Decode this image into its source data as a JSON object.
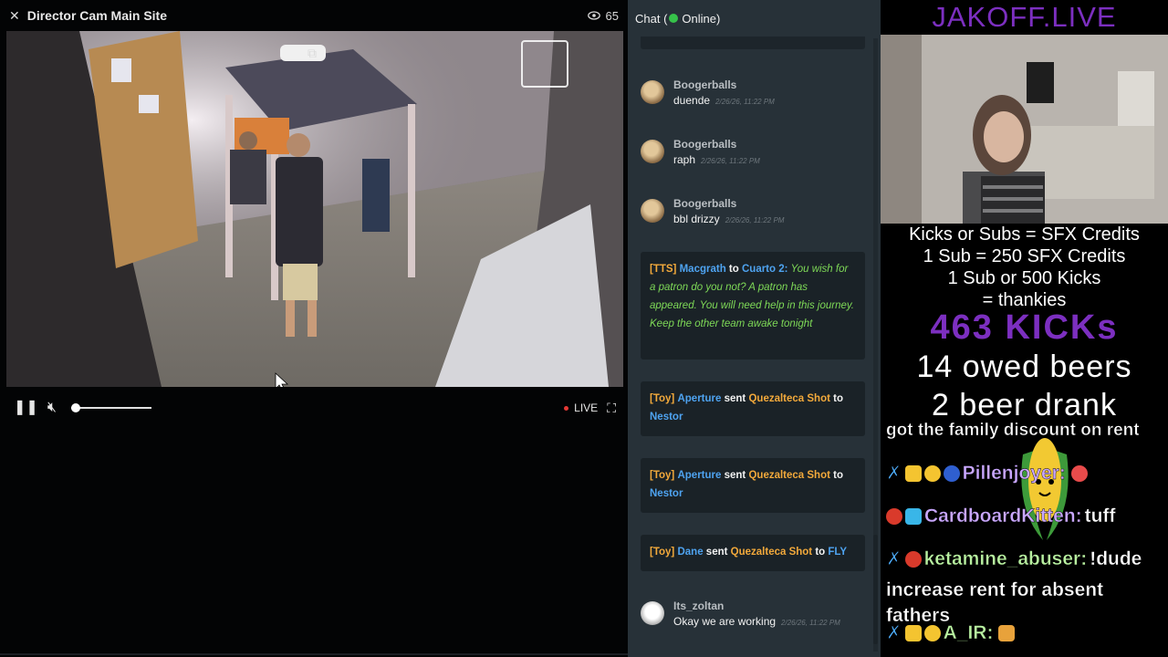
{
  "player": {
    "title": "Director Cam Main Site",
    "viewer_count": "65",
    "live_label": "LIVE",
    "volume_fraction": 0.0
  },
  "chat": {
    "header_label": "Chat (",
    "status_label": "Online)",
    "messages": [
      {
        "type": "message",
        "username": "Boogerballs",
        "text": "duende",
        "time": "2/26/26, 11:22 PM"
      },
      {
        "type": "message",
        "username": "Boogerballs",
        "text": "raph",
        "time": "2/26/26, 11:22 PM"
      },
      {
        "type": "message",
        "username": "Boogerballs",
        "text": "bbl drizzy",
        "time": "2/26/26, 11:22 PM"
      },
      {
        "type": "tts",
        "tag": "[TTS]",
        "sender": "Macgrath",
        "connector": "to",
        "target": "Cuarto 2:",
        "text": "You wish for a patron do you not? A patron has appeared. You will need help in this journey. Keep the other team awake tonight"
      },
      {
        "type": "toy",
        "tag": "[Toy]",
        "sender": "Aperture",
        "verb": "sent",
        "item": "Quezalteca Shot",
        "connector": "to",
        "target": "Nestor"
      },
      {
        "type": "toy",
        "tag": "[Toy]",
        "sender": "Aperture",
        "verb": "sent",
        "item": "Quezalteca Shot",
        "connector": "to",
        "target": "Nestor"
      },
      {
        "type": "toy",
        "tag": "[Toy]",
        "sender": "Dane",
        "verb": "sent",
        "item": "Quezalteca Shot",
        "connector": "to",
        "target": "FLY"
      },
      {
        "type": "message",
        "username": "Its_zoltan",
        "text": "Okay we are working",
        "time": "2/26/26, 11:22 PM"
      }
    ]
  },
  "overlay": {
    "title": "JAKOFF.LIVE",
    "lines": [
      "Kicks or Subs = SFX Credits",
      "1 Sub = 250 SFX Credits",
      "1 Sub or 500 Kicks",
      "= thankies"
    ],
    "kicks": "463 KICKs",
    "beers_owed": "14 owed beers",
    "beers_drank": "2 beer drank",
    "family_line": "got the family discount on rent",
    "chat": [
      {
        "name": "Pillenjoyer:",
        "text": "",
        "name_color": "#c9a7ff"
      },
      {
        "name": "CardboardKitten:",
        "text": "tuff",
        "name_color": "#c9a7ff"
      },
      {
        "name": "ketamine_abuser:",
        "text": "!dude",
        "name_color": "#b8f0a0"
      },
      {
        "name": "",
        "text": "increase rent for absent fathers",
        "name_color": "#ffffff"
      },
      {
        "name": "A_IR:",
        "text": "",
        "name_color": "#b8f0a0"
      }
    ]
  },
  "colors": {
    "chat_bg": "#273138",
    "event_bg": "#1a2227",
    "accent_orange": "#f2a93b",
    "accent_blue": "#4ea3f0",
    "tts_text": "#7ed957",
    "online": "#36c24a",
    "overlay_purple": "#7c2fc0"
  },
  "icons": [
    "close-icon",
    "eye-icon",
    "popout-icon",
    "pause-icon",
    "mute-icon",
    "fullscreen-icon",
    "online-dot-icon"
  ]
}
